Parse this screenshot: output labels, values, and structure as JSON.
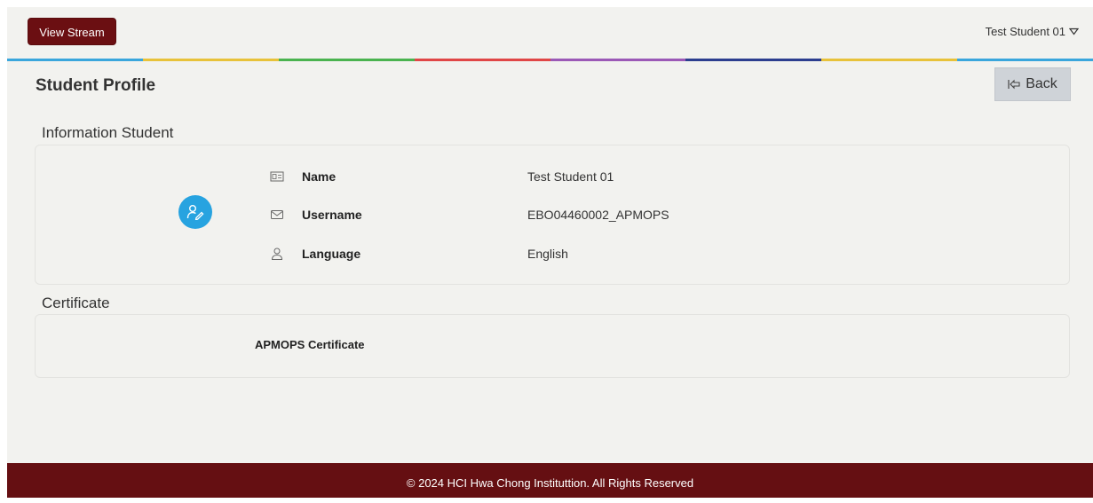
{
  "header": {
    "view_stream_label": "View Stream",
    "user_name": "Test Student 01"
  },
  "page": {
    "title": "Student Profile",
    "back_label": "Back"
  },
  "info_section": {
    "title": "Information Student",
    "rows": [
      {
        "label": "Name",
        "value": "Test Student 01",
        "icon": "id-card-icon"
      },
      {
        "label": "Username",
        "value": "EBO04460002_APMOPS",
        "icon": "envelope-icon"
      },
      {
        "label": "Language",
        "value": "English",
        "icon": "user-icon"
      }
    ]
  },
  "certificate_section": {
    "title": "Certificate",
    "items": [
      {
        "label": "APMOPS Certificate"
      }
    ]
  },
  "footer": {
    "text": "© 2024 HCI Hwa Chong Instituttion. All Rights Reserved"
  },
  "colors": {
    "primary": "#6b0f12",
    "footer_bg": "#650f12",
    "avatar_blue": "#27a3e0",
    "background": "#f2f2ef",
    "rainbow": [
      "#3aa6dc",
      "#e8c23a",
      "#4ab34f",
      "#e04646",
      "#9b59b6",
      "#2c3e8f",
      "#e8c23a",
      "#3aa6dc"
    ]
  }
}
